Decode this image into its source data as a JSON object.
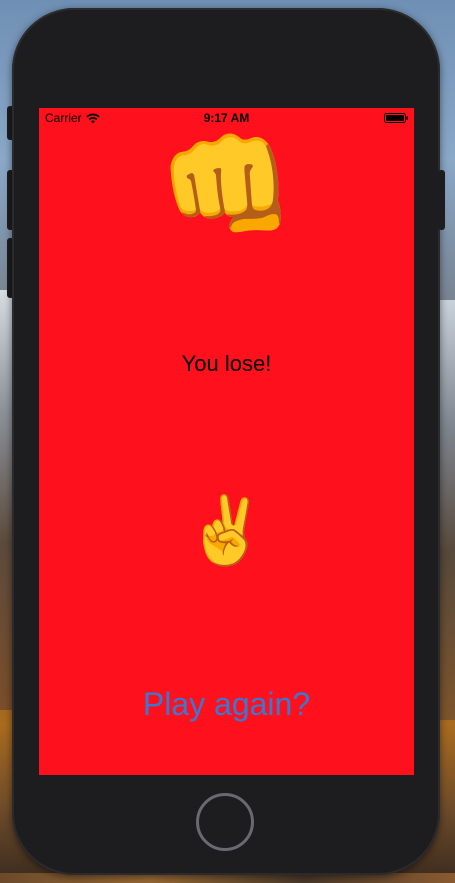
{
  "status_bar": {
    "carrier": "Carrier",
    "time": "9:17 AM",
    "wifi_icon": "wifi-icon",
    "battery_icon": "battery-icon"
  },
  "game": {
    "computer_move": "👊",
    "result": "You lose!",
    "player_move": "✌️",
    "play_again_label": "Play again?"
  },
  "colors": {
    "background": "#fe111c",
    "play_again": "#3a78d6"
  }
}
